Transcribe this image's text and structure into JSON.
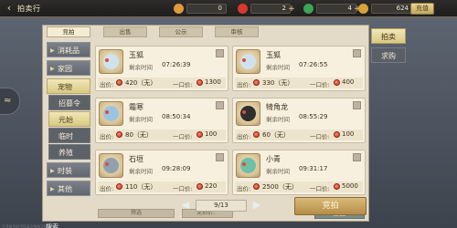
{
  "header": {
    "back_icon": "back-arrow-icon",
    "title": "拍卖行",
    "currencies": [
      {
        "icon": "gold-ingot-icon",
        "value": "0",
        "color": "#e09a3c"
      },
      {
        "icon": "red-gem-icon",
        "value": "2",
        "color": "#d9382c"
      },
      {
        "icon": "green-jade-icon",
        "value": "4",
        "color": "#3ea456"
      },
      {
        "icon": "gold-coin-icon",
        "value": "624",
        "color": "#d8a23a"
      }
    ],
    "recharge_label": "充值"
  },
  "tabs": [
    "竞拍",
    "出售",
    "公示",
    "审核"
  ],
  "active_tab": 0,
  "categories": [
    {
      "label": "消耗品",
      "kind": "main"
    },
    {
      "label": "家园",
      "kind": "main"
    },
    {
      "label": "宠物",
      "kind": "main",
      "active": true
    },
    {
      "label": "招募令",
      "kind": "sub"
    },
    {
      "label": "元始",
      "kind": "sub",
      "active": true
    },
    {
      "label": "临时",
      "kind": "sub"
    },
    {
      "label": "养殖",
      "kind": "sub"
    },
    {
      "label": "时装",
      "kind": "main"
    },
    {
      "label": "其他",
      "kind": "main"
    }
  ],
  "labels": {
    "time_remaining": "剩余时间",
    "bid_price": "出价:",
    "buyout_price": "一口价:"
  },
  "items": [
    {
      "name": "玉狐",
      "time": "07:26:39",
      "bid": "420（无）",
      "buyout": "1300",
      "pet_color": "#cfe3ef"
    },
    {
      "name": "玉狐",
      "time": "07:26:55",
      "bid": "330（无）",
      "buyout": "400",
      "pet_color": "#cfe3ef"
    },
    {
      "name": "霜寒",
      "time": "08:50:34",
      "bid": "80（无）",
      "buyout": "100",
      "pet_color": "#9cc3e2"
    },
    {
      "name": "犄角龙",
      "time": "08:55:29",
      "bid": "60（无）",
      "buyout": "100",
      "pet_color": "#2f2f2f"
    },
    {
      "name": "石垣",
      "time": "09:28:09",
      "bid": "110（无）",
      "buyout": "220",
      "pet_color": "#8ea2b0"
    },
    {
      "name": "小青",
      "time": "09:31:17",
      "bid": "2500（无）",
      "buyout": "5000",
      "pet_color": "#6fbfa9"
    }
  ],
  "filter_label": "筛选",
  "price_sort_label": "竞拍价：",
  "return_label": "返回",
  "right_tabs": [
    "拍卖",
    "求购"
  ],
  "search_label": "搜索",
  "pager": {
    "value": "9/13"
  },
  "auction_label": "竞拍",
  "user_id": "13826359299297"
}
